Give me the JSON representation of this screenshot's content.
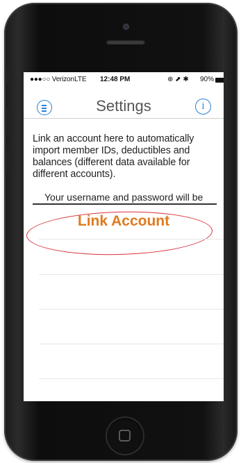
{
  "status_bar": {
    "carrier": "●●●○○ Verizon",
    "network": "LTE",
    "time": "12:48 PM",
    "icons": "⊕ ⬈ ✱",
    "battery": "90%"
  },
  "nav": {
    "title": "Settings",
    "info_glyph": "i"
  },
  "content": {
    "description": "Link an account here to automatically import member IDs, deductibles and balances (different data available for different accounts).",
    "description_cont": "Your username and password will be",
    "link_account_label": "Link Account"
  },
  "colors": {
    "accent_blue": "#2a7fd4",
    "link_orange": "#e07a1f",
    "annotation_red": "#d9303a"
  },
  "icons": [
    "menu-icon",
    "info-icon",
    "battery-icon",
    "home-button-icon"
  ]
}
